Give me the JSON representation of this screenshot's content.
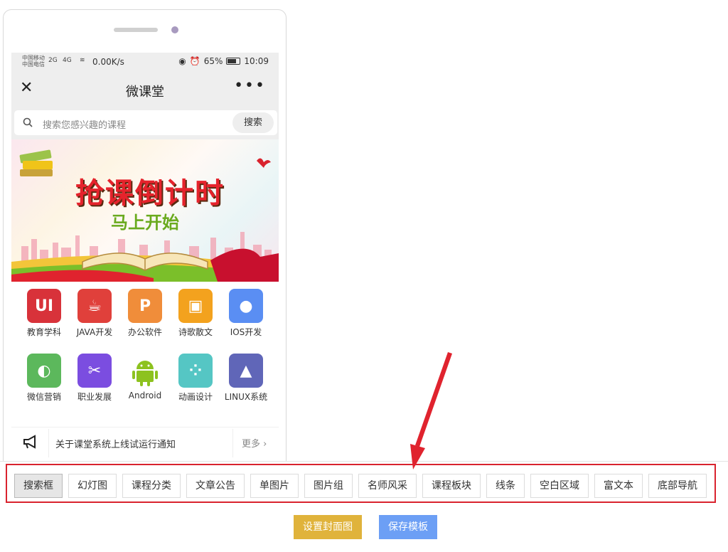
{
  "status_bar": {
    "carrier1": "中国移动",
    "carrier2": "中国电信",
    "signal1": "2G",
    "signal2": "4G",
    "net_speed": "0.00K/s",
    "battery": "65%",
    "time": "10:09"
  },
  "titlebar": {
    "title": "微课堂",
    "close_icon": "close-icon",
    "more_icon": "more-dots-icon"
  },
  "search": {
    "placeholder": "搜索您感兴趣的课程",
    "button": "搜索"
  },
  "banner": {
    "title": "抢课倒计时",
    "subtitle": "马上开始"
  },
  "categories": [
    {
      "label": "教育学科",
      "glyph": "UI",
      "color": "#d8323a"
    },
    {
      "label": "JAVA开发",
      "glyph": "☕",
      "color": "#e0403b"
    },
    {
      "label": "办公软件",
      "glyph": "P",
      "color": "#f08d3a"
    },
    {
      "label": "诗歌散文",
      "glyph": "▣",
      "color": "#f3a21e"
    },
    {
      "label": "IOS开发",
      "glyph": "",
      "color": "#5a8ef3"
    },
    {
      "label": "微信营销",
      "glyph": "🎨",
      "color": "#5cb85c"
    },
    {
      "label": "职业发展",
      "glyph": "✂",
      "color": "#7b4de0"
    },
    {
      "label": "Android",
      "glyph": "🤖",
      "color": "#ffffff"
    },
    {
      "label": "动画设计",
      "glyph": "⁘",
      "color": "#55c6c4"
    },
    {
      "label": "LINUX系统",
      "glyph": "🐧",
      "color": "#6066b8"
    }
  ],
  "notice": {
    "text": "关于课堂系统上线试运行通知",
    "more": "更多 ›"
  },
  "toolbar": {
    "items": [
      "搜索框",
      "幻灯图",
      "课程分类",
      "文章公告",
      "单图片",
      "图片组",
      "名师风采",
      "课程板块",
      "线条",
      "空白区域",
      "富文本",
      "底部导航"
    ],
    "active": "搜索框"
  },
  "actions": {
    "cover": "设置封面图",
    "save": "保存模板"
  },
  "colors": {
    "highlight": "#d9232e",
    "cover_btn": "#e0b33b",
    "save_btn": "#6c9ff5"
  }
}
